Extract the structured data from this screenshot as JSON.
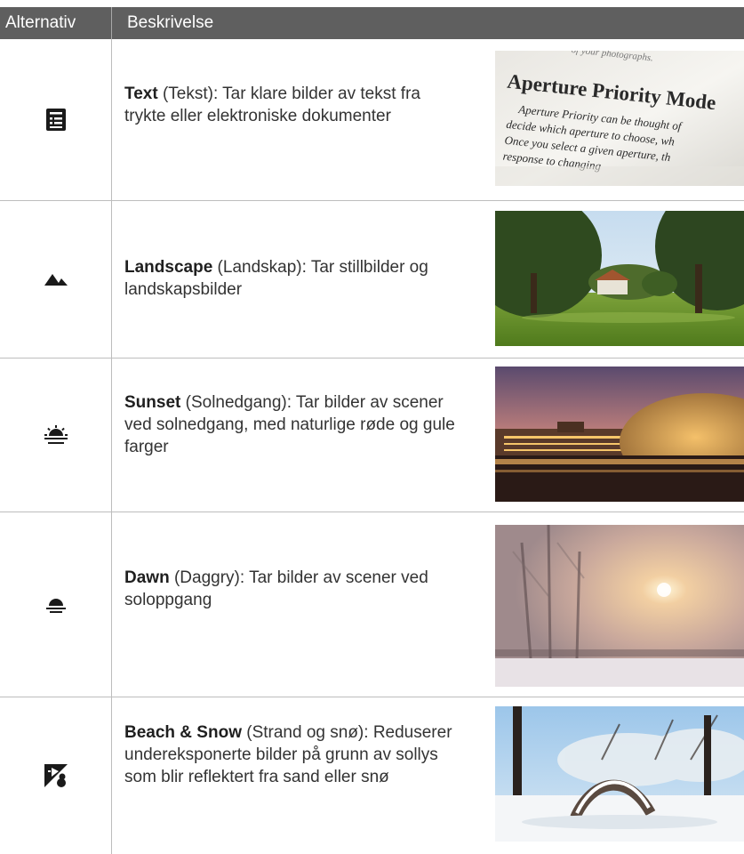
{
  "header": {
    "col_option": "Alternativ",
    "col_description": "Beskrivelse"
  },
  "rows": [
    {
      "icon": "text-mode-icon",
      "title": "Text",
      "subtitle": " (Tekst): Tar klare bilder av tekst fra trykte eller elektroniske dokumenter",
      "image": {
        "heading": "Aperture Priority Mode",
        "top_fragment": "of your photographs.",
        "lines": [
          "Aperture Priority can be thought of",
          "decide which aperture to choose, wh",
          "Once you select a given aperture, th",
          "response to changing"
        ]
      }
    },
    {
      "icon": "landscape-mode-icon",
      "title": "Landscape",
      "subtitle": " (Landskap): Tar stillbilder og landskapsbilder"
    },
    {
      "icon": "sunset-mode-icon",
      "title": "Sunset",
      "subtitle": " (Solnedgang): Tar bilder av scener ved solnedgang, med naturlige røde og gule farger"
    },
    {
      "icon": "dawn-mode-icon",
      "title": "Dawn",
      "subtitle": " (Daggry): Tar bilder av scener ved soloppgang"
    },
    {
      "icon": "beach-snow-mode-icon",
      "title": "Beach & Snow",
      "subtitle": " (Strand og snø): Reduserer undereksponerte bilder på grunn av sollys som blir reflektert fra sand eller snø"
    }
  ],
  "colors": {
    "header_bg": "#5f5f5f",
    "divider": "#bdbdbd",
    "icon": "#1a1a1a"
  }
}
